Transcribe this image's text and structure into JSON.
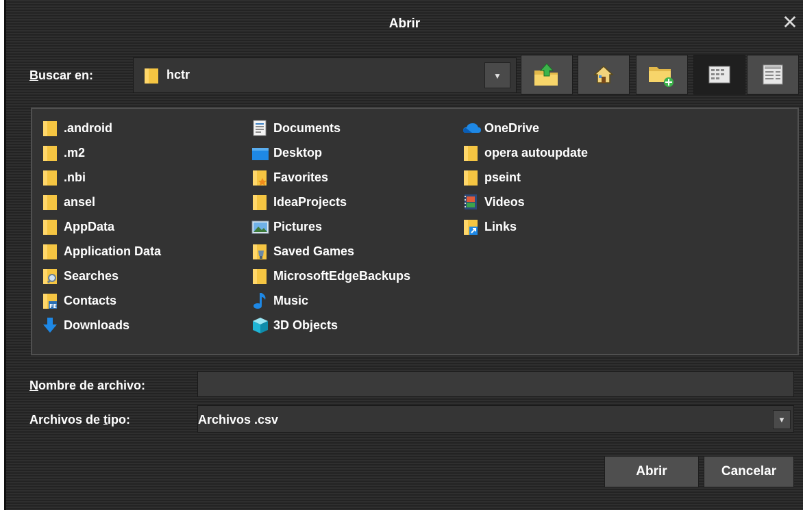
{
  "window": {
    "title": "Abrir",
    "close_glyph": "✕"
  },
  "toolbar": {
    "look_in_label": "Buscar en:",
    "look_in_value": "hctr",
    "buttons": [
      "up-one-level-icon",
      "home-icon",
      "new-folder-icon",
      "list-view-icon",
      "details-view-icon"
    ]
  },
  "files": {
    "columns": [
      [
        {
          "name": ".android",
          "icon": "folder-icon"
        },
        {
          "name": ".m2",
          "icon": "folder-icon"
        },
        {
          "name": ".nbi",
          "icon": "folder-icon"
        },
        {
          "name": "ansel",
          "icon": "folder-icon"
        },
        {
          "name": "AppData",
          "icon": "folder-icon"
        },
        {
          "name": "Application Data",
          "icon": "folder-icon"
        },
        {
          "name": "Searches",
          "icon": "searches-folder-icon"
        },
        {
          "name": "Contacts",
          "icon": "contacts-folder-icon"
        },
        {
          "name": "Downloads",
          "icon": "downloads-icon"
        }
      ],
      [
        {
          "name": "Documents",
          "icon": "documents-icon"
        },
        {
          "name": "Desktop",
          "icon": "desktop-icon"
        },
        {
          "name": "Favorites",
          "icon": "favorites-folder-icon"
        },
        {
          "name": "IdeaProjects",
          "icon": "folder-icon"
        },
        {
          "name": "Pictures",
          "icon": "pictures-icon"
        },
        {
          "name": "Saved Games",
          "icon": "saved-games-icon"
        },
        {
          "name": "MicrosoftEdgeBackups",
          "icon": "folder-icon"
        },
        {
          "name": "Music",
          "icon": "music-icon"
        },
        {
          "name": "3D Objects",
          "icon": "3d-objects-icon"
        }
      ],
      [
        {
          "name": "OneDrive",
          "icon": "onedrive-icon"
        },
        {
          "name": "opera autoupdate",
          "icon": "folder-icon"
        },
        {
          "name": "pseint",
          "icon": "folder-icon"
        },
        {
          "name": "Videos",
          "icon": "videos-icon"
        },
        {
          "name": "Links",
          "icon": "links-folder-icon"
        }
      ]
    ]
  },
  "filename": {
    "label": "Nombre de archivo:",
    "value": ""
  },
  "filetype": {
    "label": "Archivos de tipo:",
    "value": "Archivos .csv"
  },
  "actions": {
    "open_label": "Abrir",
    "cancel_label": "Cancelar"
  },
  "colors": {
    "folder": "#f5c542",
    "accent_blue": "#1e88e5",
    "background": "#2b2b2b"
  }
}
